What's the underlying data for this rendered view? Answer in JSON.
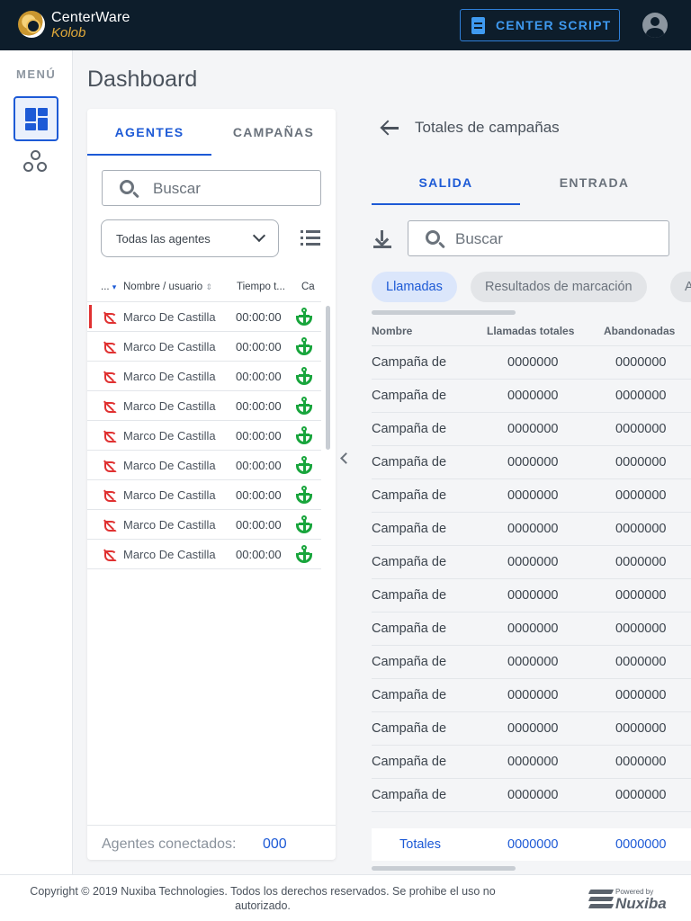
{
  "header": {
    "brand_line1": "CenterWare",
    "brand_line2": "Kolob",
    "center_script_label": "CENTER SCRIPT"
  },
  "sidebar": {
    "menu_label": "MENÚ"
  },
  "page_title": "Dashboard",
  "agents_panel": {
    "tabs": [
      "AGENTES",
      "CAMPAÑAS"
    ],
    "active_tab": "AGENTES",
    "search_placeholder": "Buscar",
    "filter_value": "Todas las agentes",
    "columns": [
      "...",
      "Nombre / usuario",
      "Tiempo t...",
      "Ca"
    ],
    "rows": [
      {
        "name": "Marco De Castilla",
        "time": "00:00:00"
      },
      {
        "name": "Marco De Castilla",
        "time": "00:00:00"
      },
      {
        "name": "Marco De Castilla",
        "time": "00:00:00"
      },
      {
        "name": "Marco De Castilla",
        "time": "00:00:00"
      },
      {
        "name": "Marco De Castilla",
        "time": "00:00:00"
      },
      {
        "name": "Marco De Castilla",
        "time": "00:00:00"
      },
      {
        "name": "Marco De Castilla",
        "time": "00:00:00"
      },
      {
        "name": "Marco De Castilla",
        "time": "00:00:00"
      },
      {
        "name": "Marco De Castilla",
        "time": "00:00:00"
      }
    ],
    "connected_label": "Agentes conectados:",
    "connected_value": "000"
  },
  "campaigns_panel": {
    "title": "Totales de campañas",
    "tabs": [
      "SALIDA",
      "ENTRADA"
    ],
    "active_tab": "SALIDA",
    "search_placeholder": "Buscar",
    "chips": [
      "Llamadas",
      "Resultados de marcación",
      "A"
    ],
    "active_chip": "Llamadas",
    "columns": [
      "Nombre",
      "Llamadas totales",
      "Abandonadas"
    ],
    "rows": [
      {
        "name": "Campaña de",
        "total": "0000000",
        "abandoned": "0000000"
      },
      {
        "name": "Campaña de",
        "total": "0000000",
        "abandoned": "0000000"
      },
      {
        "name": "Campaña de",
        "total": "0000000",
        "abandoned": "0000000"
      },
      {
        "name": "Campaña de",
        "total": "0000000",
        "abandoned": "0000000"
      },
      {
        "name": "Campaña de",
        "total": "0000000",
        "abandoned": "0000000"
      },
      {
        "name": "Campaña de",
        "total": "0000000",
        "abandoned": "0000000"
      },
      {
        "name": "Campaña de",
        "total": "0000000",
        "abandoned": "0000000"
      },
      {
        "name": "Campaña de",
        "total": "0000000",
        "abandoned": "0000000"
      },
      {
        "name": "Campaña de",
        "total": "0000000",
        "abandoned": "0000000"
      },
      {
        "name": "Campaña de",
        "total": "0000000",
        "abandoned": "0000000"
      },
      {
        "name": "Campaña de",
        "total": "0000000",
        "abandoned": "0000000"
      },
      {
        "name": "Campaña de",
        "total": "0000000",
        "abandoned": "0000000"
      },
      {
        "name": "Campaña de",
        "total": "0000000",
        "abandoned": "0000000"
      },
      {
        "name": "Campaña de",
        "total": "0000000",
        "abandoned": "0000000"
      }
    ],
    "totals": {
      "label": "Totales",
      "total": "0000000",
      "abandoned": "0000000"
    }
  },
  "footer": {
    "copyright": "Copyright © 2019 Nuxiba Technologies. Todos los derechos reservados. Se prohibe el uso no autorizado.",
    "powered_by": "Powered by",
    "vendor": "Nuxiba"
  },
  "colors": {
    "accent": "#1d5ad6",
    "topbar": "#0d1d2b",
    "status_red": "#e03131",
    "status_green": "#18a53c"
  }
}
